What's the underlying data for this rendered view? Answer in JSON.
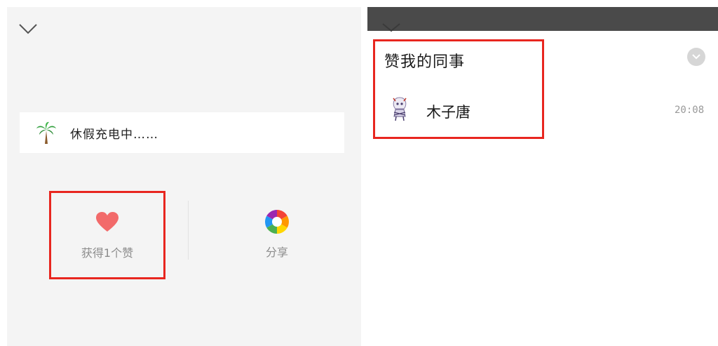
{
  "left": {
    "status": {
      "icon": "palm-tree-icon",
      "text": "休假充电中……"
    },
    "actions": {
      "like": {
        "icon": "heart-icon",
        "label": "获得1个赞"
      },
      "share": {
        "icon": "aperture-icon",
        "label": "分享"
      }
    }
  },
  "right": {
    "section_title": "赞我的同事",
    "likers": [
      {
        "name": "木子唐",
        "time": "20:08",
        "avatar": "avatar-icon"
      }
    ]
  },
  "colors": {
    "highlight_box": "#e8261f",
    "heart": "#f26a6a",
    "panel_bg": "#f4f4f4",
    "dark_bar": "#4a4a4a"
  }
}
